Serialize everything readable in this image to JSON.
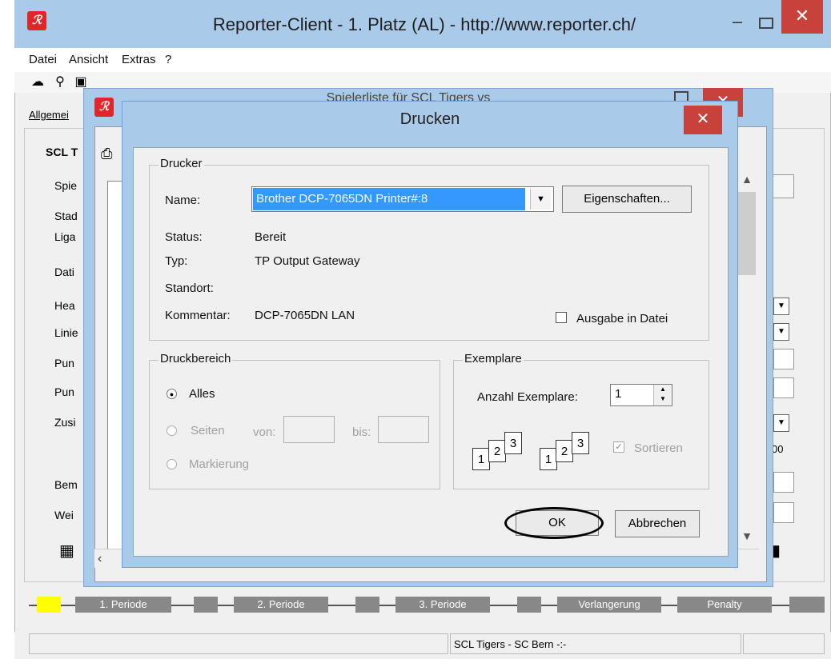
{
  "main_window": {
    "title": "Reporter-Client  -  1. Platz (AL)  -  http://www.reporter.ch/",
    "min_symbol": "–",
    "close_symbol": "✕"
  },
  "menu": [
    "Datei",
    "Ansicht",
    "Extras",
    "?"
  ],
  "background": {
    "tab_label": "Allgemei",
    "group_title": "SCL T",
    "labels": [
      "Spie",
      "Stad",
      "Liga",
      "Dati",
      "Hea",
      "Linie",
      "Pun",
      "Pun",
      "Zusi",
      "Bem",
      "Wei"
    ],
    "right_fragment": "00"
  },
  "spielerliste": {
    "title_fragment": "Spielerliste für SCL Tigers vs",
    "close_symbol": "✕",
    "scroll_up": "▲",
    "scroll_down": "▼",
    "scroll_left": "‹"
  },
  "dialog": {
    "title": "Drucken",
    "close_symbol": "✕",
    "printer": {
      "legend": "Drucker",
      "name_label": "Name:",
      "name_value": "Brother DCP-7065DN Printer#:8",
      "properties_button": "Eigenschaften...",
      "status_label": "Status:",
      "status_value": "Bereit",
      "type_label": "Typ:",
      "type_value": "TP Output Gateway",
      "location_label": "Standort:",
      "location_value": "",
      "comment_label": "Kommentar:",
      "comment_value": "DCP-7065DN LAN",
      "print_to_file": "Ausgabe in Datei",
      "print_to_file_checked": false
    },
    "range": {
      "legend": "Druckbereich",
      "all": "Alles",
      "pages": "Seiten",
      "from_label": "von:",
      "to_label": "bis:",
      "selection": "Markierung",
      "selected": "all"
    },
    "copies": {
      "legend": "Exemplare",
      "count_label": "Anzahl Exemplare:",
      "count_value": "1",
      "collate": "Sortieren",
      "collate_checked": true,
      "page_numbers": [
        "1",
        "2",
        "3"
      ]
    },
    "ok_button": "OK",
    "cancel_button": "Abbrechen"
  },
  "periods": [
    "1. Periode",
    "2. Periode",
    "3. Periode",
    "Verlangerung",
    "Penalty"
  ],
  "status_bar": {
    "center": "SCL Tigers - SC Bern -:-"
  },
  "colors": {
    "title_bar": "#a9cbe9",
    "close_red": "#c7423b",
    "selection_blue": "#3399ff",
    "period_active": "#ffff00"
  }
}
